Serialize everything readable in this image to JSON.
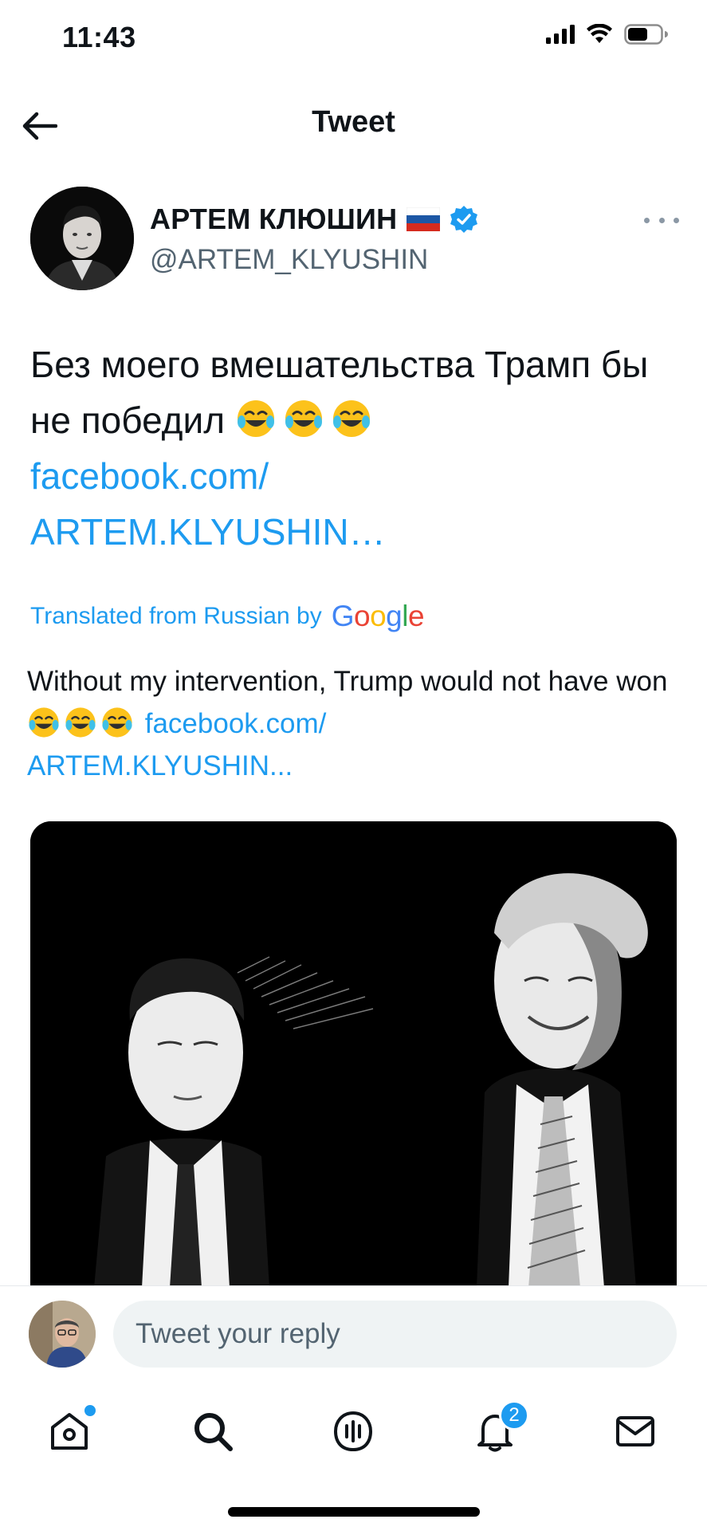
{
  "status_bar": {
    "time": "11:43"
  },
  "nav": {
    "title": "Tweet"
  },
  "author": {
    "name": "АРТЕМ КЛЮШИН",
    "handle": "@ARTEM_KLYUSHIN"
  },
  "tweet": {
    "text_part1": "Без моего вмешательства Трамп бы не победил",
    "link_part1": "facebook.com/",
    "link_part2": "ARTEM.KLYUSHIN…"
  },
  "translation": {
    "label": "Translated from Russian by",
    "provider": "Google",
    "text": "Without my intervention, Trump would not have won",
    "link_part1": "facebook.com/",
    "link_part2": "ARTEM.KLYUSHIN..."
  },
  "reply": {
    "placeholder": "Tweet your reply"
  },
  "tabs": {
    "notifications_badge": "2"
  },
  "colors": {
    "link": "#1d9bf0",
    "text": "#0f1419",
    "secondary": "#536471",
    "input_bg": "#eff3f4"
  }
}
